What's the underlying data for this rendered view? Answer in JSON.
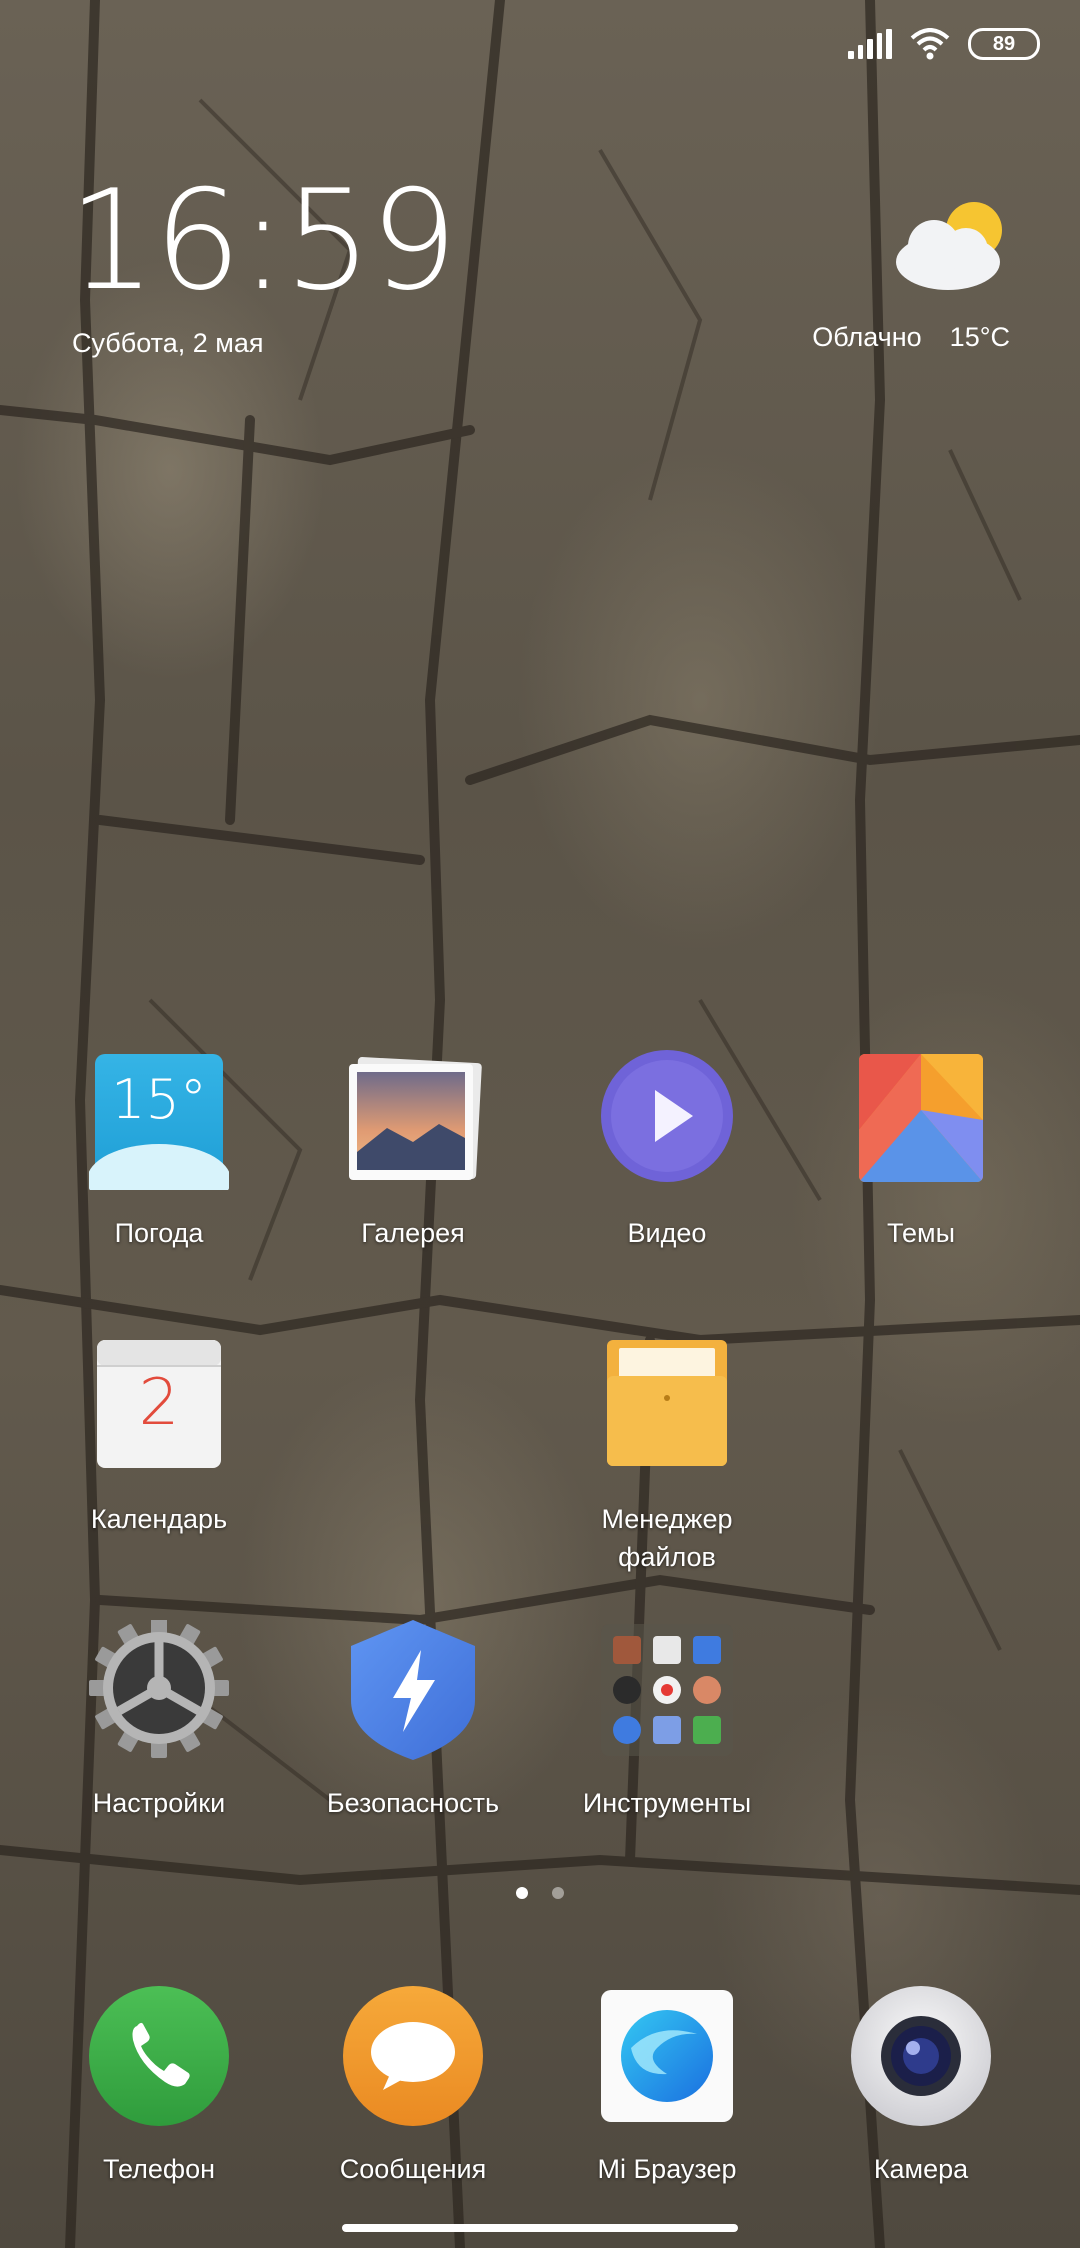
{
  "status_bar": {
    "battery": "89"
  },
  "clock": {
    "time": "16:59",
    "date": "Суббота, 2 мая"
  },
  "weather": {
    "condition": "Облачно",
    "temperature": "15°C"
  },
  "apps": {
    "weather": {
      "label": "Погода",
      "icon_text": "15°"
    },
    "gallery": {
      "label": "Галерея"
    },
    "video": {
      "label": "Видео"
    },
    "themes": {
      "label": "Темы"
    },
    "calendar": {
      "label": "Календарь",
      "icon_text": "2"
    },
    "files": {
      "label": "Менеджер\nфайлов",
      "label_line1": "Менеджер",
      "label_line2": "файлов"
    },
    "settings": {
      "label": "Настройки"
    },
    "security": {
      "label": "Безопасность"
    },
    "tools": {
      "label": "Инструменты"
    }
  },
  "dock": {
    "phone": {
      "label": "Телефон"
    },
    "messages": {
      "label": "Сообщения"
    },
    "browser": {
      "label": "Mi Браузер"
    },
    "camera": {
      "label": "Камера"
    }
  },
  "page_indicator": {
    "pages": 2,
    "current": 1
  },
  "colors": {
    "phone_green": "#3fae49",
    "messages_orange": "#f0962a",
    "video_purple": "#6f63d8",
    "security_blue": "#4a80e8"
  }
}
